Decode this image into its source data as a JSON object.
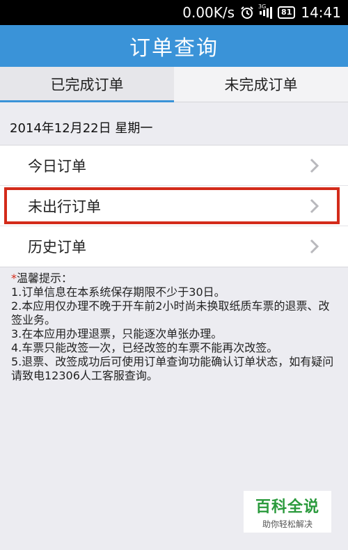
{
  "status_bar": {
    "speed": "0.00K/s",
    "network_tag": "3G",
    "battery": "81",
    "time": "14:41"
  },
  "title": "订单查询",
  "tabs": [
    {
      "label": "已完成订单",
      "active": true
    },
    {
      "label": "未完成订单",
      "active": false
    }
  ],
  "date_text": "2014年12月22日 星期一",
  "menu": [
    {
      "label": "今日订单"
    },
    {
      "label": "未出行订单"
    },
    {
      "label": "历史订单"
    }
  ],
  "tips": {
    "asterisk": "*",
    "heading": "温馨提示：",
    "items": [
      "1.订单信息在本系统保存期限不少于30日。",
      "2.本应用仅办理不晚于开车前2小时尚未换取纸质车票的退票、改签业务。",
      "3.在本应用办理退票，只能逐次单张办理。",
      "4.车票只能改签一次，已经改签的车票不能再次改签。",
      "5.退票、改签成功后可使用订单查询功能确认订单状态，如有疑问请致电12306人工客服查询。"
    ]
  },
  "watermark": {
    "main": "百科全说",
    "sub": "助你轻松解决"
  },
  "colors": {
    "title_bar": "#3a93d8",
    "highlight_border": "#d32b1a",
    "watermark_green": "#2a9a3c"
  }
}
